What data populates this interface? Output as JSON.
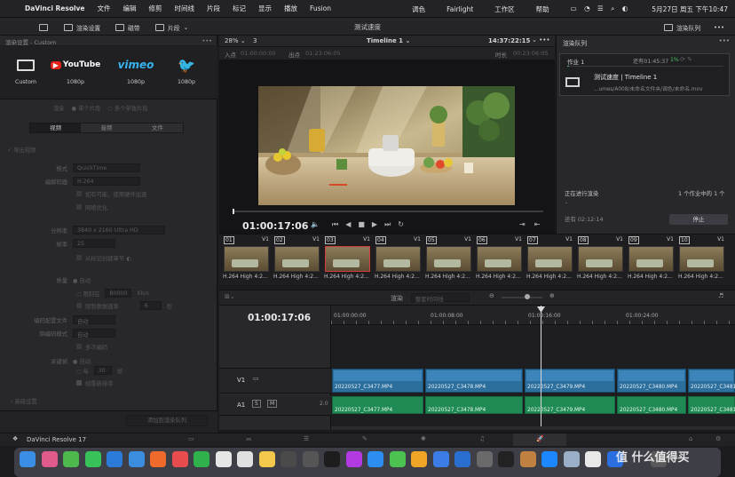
{
  "menubar": {
    "app": "DaVinci Resolve",
    "items": [
      "文件",
      "编辑",
      "修剪",
      "时间线",
      "片段",
      "标记",
      "显示",
      "播放",
      "Fusion"
    ],
    "right_items": [
      "调色",
      "Fairlight",
      "工作区",
      "帮助"
    ],
    "datetime": "5月27日 周五 下午10:47",
    "project_title": "测试速度"
  },
  "toolbar": {
    "render_settings": "渲染设置",
    "clips_label": "磁带",
    "clip_mode": "片段",
    "render_queue": "渲染队列"
  },
  "render_settings": {
    "header": "渲染设置 - Custom",
    "presets": [
      {
        "name": "Custom",
        "sub": "",
        "icon": "film-icon"
      },
      {
        "name": "YouTube",
        "sub": "1080p",
        "icon": "youtube-logo"
      },
      {
        "name": "vimeo",
        "sub": "1080p",
        "icon": "vimeo-logo"
      },
      {
        "name": "twitter",
        "sub": "1080p",
        "icon": "twitter-logo"
      }
    ],
    "render_label": "渲染",
    "single_clip": "单个片段",
    "multi_clip": "多个单独片段",
    "tabs": [
      "视频",
      "音频",
      "文件"
    ],
    "export_video": "导出视频",
    "format_label": "格式",
    "format_value": "QuickTime",
    "codec_label": "编解码器",
    "codec_value": "H.264",
    "hw_accel": "如有可能，使用硬件加速",
    "network_opt": "网络优化",
    "resolution_label": "分辨率",
    "resolution_value": "3840 x 2160 Ultra HD",
    "framerate_label": "帧率",
    "framerate_value": "25",
    "frame_from": "从标记创建章节",
    "quality_label": "质量",
    "quality_auto": "自动",
    "limit_label": "限制在",
    "limit_value": "80000",
    "limit_unit": "Kb/s",
    "kf_label": "限制数据速率",
    "kf_value": "6",
    "kf_unit": "秒",
    "profile_label": "编码配置文件",
    "profile_value": "自动",
    "entropy_label": "熵编码模式",
    "entropy_value": "自动",
    "multipass": "多次编码",
    "keyframe_label": "关键帧",
    "keyframe_auto": "自动",
    "keyframe_every": "每",
    "keyframe_num": "30",
    "keyframe_unit": "帧",
    "frame_reorder": "帧重新排序",
    "advanced": "高级设置",
    "add_queue": "添加到渲染队列"
  },
  "viewer": {
    "zoom": "28%",
    "zoom_num": "3",
    "timeline": "Timeline 1",
    "tc_top": "14:37:22:15",
    "in_label": "入点",
    "in_tc": "01:00:00:00",
    "out_label": "出点",
    "out_tc": "01:23:06:05",
    "dur_label": "时长",
    "dur_tc": "00:23:06:05",
    "tc_main": "01:00:17:06"
  },
  "render_queue": {
    "title": "渲染队列",
    "job_name": "作业 1",
    "job_status": "还有01:45:37",
    "job_pct": "1%",
    "job_title": "测试速度 | Timeline 1",
    "job_path": "...umes/A008/未命名文件夹/调色/未命名.mov",
    "rendering": "正在进行渲染",
    "count": "1 个作业中的 1 个",
    "remaining": "还有 02:12:14",
    "stop": "停止",
    "progress_dash": "-"
  },
  "clips": [
    {
      "n": "01",
      "t": "V1",
      "cap": "H.264 High 4:2..."
    },
    {
      "n": "02",
      "t": "V1",
      "cap": "H.264 High 4:2..."
    },
    {
      "n": "03",
      "t": "V1",
      "cap": "H.264 High 4:2..."
    },
    {
      "n": "04",
      "t": "V1",
      "cap": "H.264 High 4:2..."
    },
    {
      "n": "05",
      "t": "V1",
      "cap": "H.264 High 4:2..."
    },
    {
      "n": "06",
      "t": "V1",
      "cap": "H.264 High 4:2..."
    },
    {
      "n": "07",
      "t": "V1",
      "cap": "H.264 High 4:2..."
    },
    {
      "n": "08",
      "t": "V1",
      "cap": "H.264 High 4:2..."
    },
    {
      "n": "09",
      "t": "V1",
      "cap": "H.264 High 4:2..."
    },
    {
      "n": "10",
      "t": "V1",
      "cap": "H.264 High 4:2..."
    }
  ],
  "timeline": {
    "render_label": "渲染",
    "render_mode": "整套时间线",
    "tc": "01:00:17:06",
    "ruler": [
      "01:00:00:00",
      "01:00:08:00",
      "01:00:16:00",
      "01:00:24:00"
    ],
    "v1": "V1",
    "a1": "A1",
    "a1_s": "S",
    "a1_m": "M",
    "a1_level": "2.0",
    "v_clips": [
      "20220527_C3477.MP4",
      "20220527_C3478.MP4",
      "20220527_C3479.MP4",
      "20220527_C3480.MP4",
      "20220527_C3481.MP4"
    ],
    "a_clips": [
      "20220527_C3477.MP4",
      "20220527_C3478.MP4",
      "20220527_C3479.MP4",
      "20220527_C3480.MP4",
      "20220527_C3481.MP4"
    ]
  },
  "app_footer": "DaVinci Resolve 17",
  "watermark": "值 什么值得买"
}
